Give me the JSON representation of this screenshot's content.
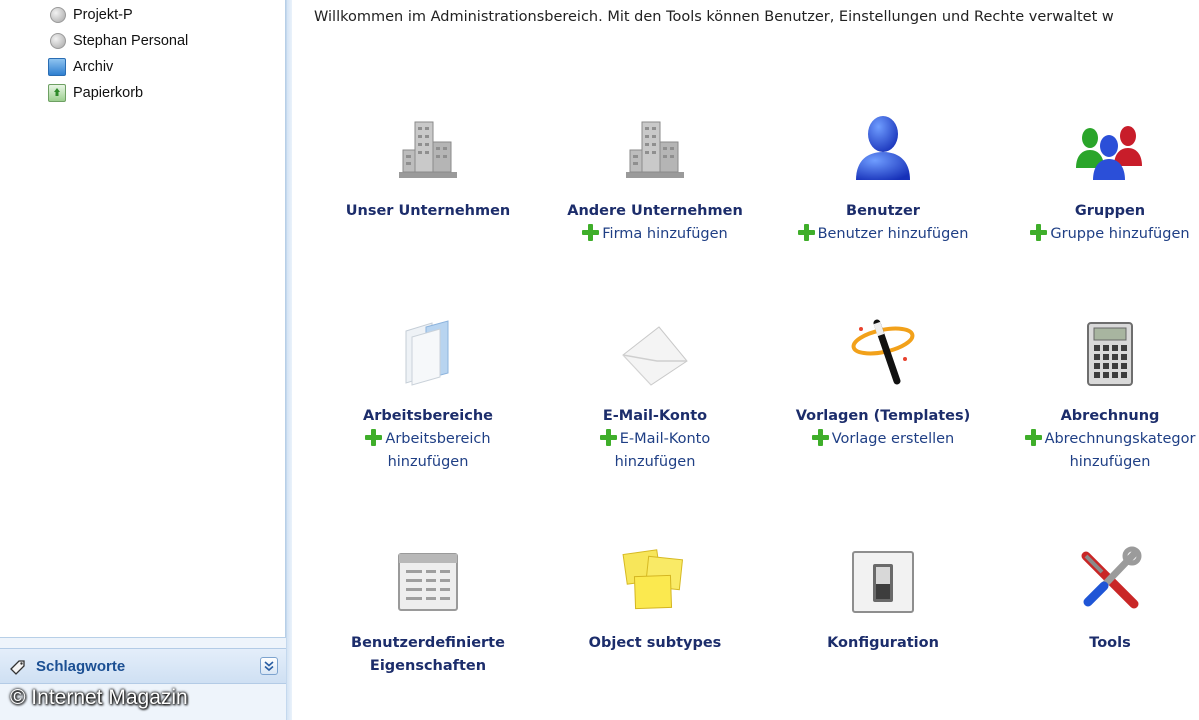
{
  "sidebar": {
    "items": [
      {
        "label": "Projekt-P",
        "icon": "workspace-circle-icon"
      },
      {
        "label": "Stephan Personal",
        "icon": "workspace-circle-icon"
      },
      {
        "label": "Archiv",
        "icon": "archive-icon"
      },
      {
        "label": "Papierkorb",
        "icon": "trash-icon"
      }
    ],
    "section": {
      "label": "Schlagworte",
      "icon": "tag-icon"
    }
  },
  "watermark": "© Internet Magazin",
  "main": {
    "welcome": "Willkommen im Administrationsbereich. Mit den Tools können Benutzer, Einstellungen und Rechte verwaltet w",
    "tools": [
      {
        "title": "Unser Unternehmen",
        "icon": "company-building-icon"
      },
      {
        "title": "Andere Unternehmen",
        "icon": "other-companies-building-icon",
        "action": "Firma hinzufügen"
      },
      {
        "title": "Benutzer",
        "icon": "user-icon",
        "action": "Benutzer hinzufügen"
      },
      {
        "title": "Gruppen",
        "icon": "groups-icon",
        "action": "Gruppe hinzufügen"
      },
      {
        "title": "Arbeitsbereiche",
        "icon": "folder-icon",
        "action": "Arbeitsbereich",
        "action2": "hinzufügen"
      },
      {
        "title": "E-Mail-Konto",
        "icon": "envelope-icon",
        "action": "E-Mail-Konto",
        "action2": "hinzufügen"
      },
      {
        "title": "Vorlagen (Templates)",
        "icon": "magic-wand-icon",
        "action": "Vorlage erstellen"
      },
      {
        "title": "Abrechnung",
        "icon": "calculator-icon",
        "action": "Abrechnungskategor",
        "action2": "hinzufügen"
      },
      {
        "title": "Benutzerdefinierte",
        "title2": "Eigenschaften",
        "icon": "custom-properties-icon"
      },
      {
        "title": "Object subtypes",
        "icon": "sticky-notes-icon"
      },
      {
        "title": "Konfiguration",
        "icon": "switch-icon"
      },
      {
        "title": "Tools",
        "icon": "tools-icon"
      }
    ]
  },
  "colors": {
    "accent": "#1c2d6b",
    "link": "#1f3f85",
    "plus": "#3fae2a",
    "section": "#1b4f93"
  }
}
